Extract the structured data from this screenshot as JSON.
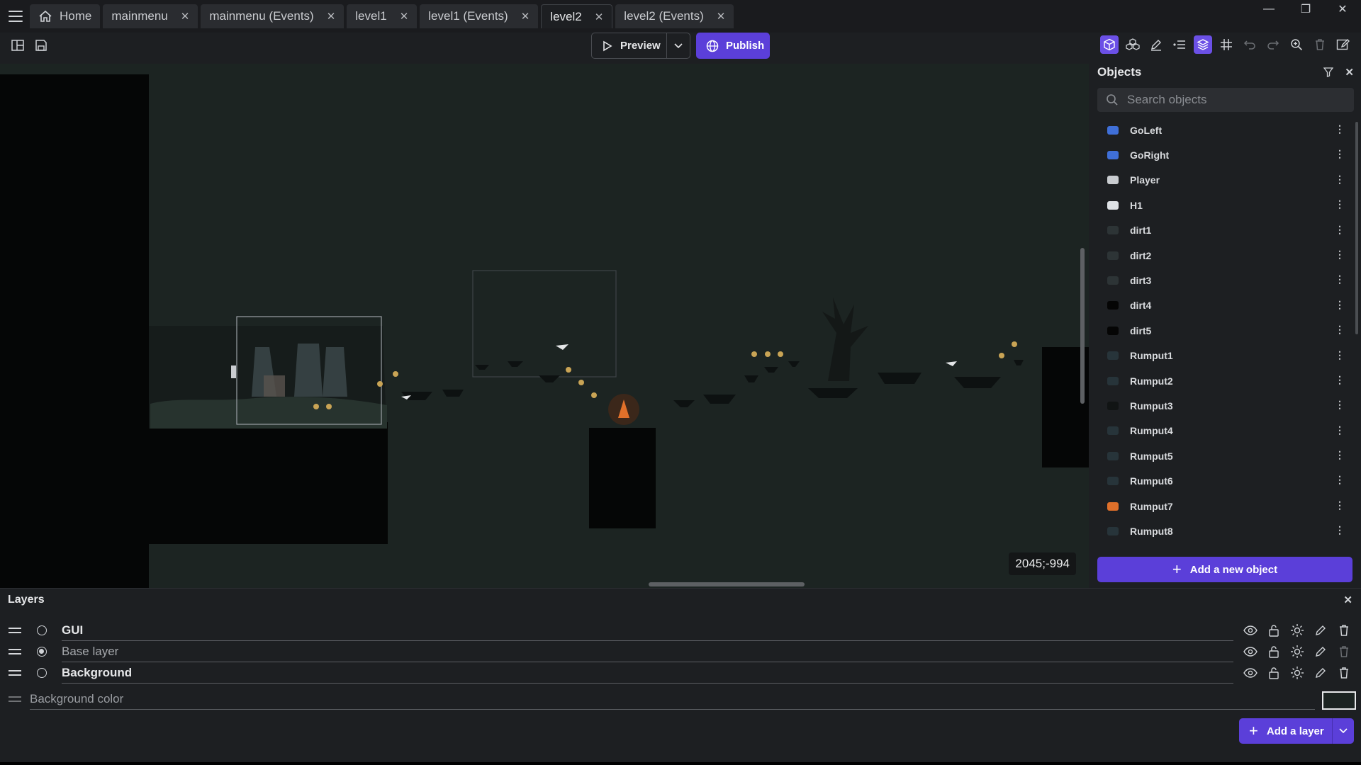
{
  "tabs": [
    {
      "label": "Home",
      "icon": "home-icon",
      "closable": false
    },
    {
      "label": "mainmenu",
      "closable": true
    },
    {
      "label": "mainmenu (Events)",
      "closable": true
    },
    {
      "label": "level1",
      "closable": true
    },
    {
      "label": "level1 (Events)",
      "closable": true
    },
    {
      "label": "level2",
      "closable": true,
      "active": true
    },
    {
      "label": "level2 (Events)",
      "closable": true
    }
  ],
  "toolbar": {
    "preview_label": "Preview",
    "publish_label": "Publish"
  },
  "canvas": {
    "coordinates": "2045;-994"
  },
  "objects_panel": {
    "title": "Objects",
    "search_placeholder": "Search objects",
    "items": [
      {
        "name": "GoLeft",
        "thumb_color": "#3f6fd8"
      },
      {
        "name": "GoRight",
        "thumb_color": "#3f6fd8"
      },
      {
        "name": "Player",
        "thumb_color": "#c9ccd0"
      },
      {
        "name": "H1",
        "thumb_color": "#dfe2e6"
      },
      {
        "name": "dirt1",
        "thumb_color": "#2d3436"
      },
      {
        "name": "dirt2",
        "thumb_color": "#2d3436"
      },
      {
        "name": "dirt3",
        "thumb_color": "#2d3436"
      },
      {
        "name": "dirt4",
        "thumb_color": "#050505"
      },
      {
        "name": "dirt5",
        "thumb_color": "#050505"
      },
      {
        "name": "Rumput1",
        "thumb_color": "#27343a"
      },
      {
        "name": "Rumput2",
        "thumb_color": "#27343a"
      },
      {
        "name": "Rumput3",
        "thumb_color": "#111414"
      },
      {
        "name": "Rumput4",
        "thumb_color": "#27343a"
      },
      {
        "name": "Rumput5",
        "thumb_color": "#27343a"
      },
      {
        "name": "Rumput6",
        "thumb_color": "#27343a"
      },
      {
        "name": "Rumput7",
        "thumb_color": "#e0702a"
      },
      {
        "name": "Rumput8",
        "thumb_color": "#27343a"
      }
    ],
    "add_label": "Add a new object"
  },
  "layers_panel": {
    "title": "Layers",
    "layers": [
      {
        "name": "GUI",
        "selected": false
      },
      {
        "name": "Base layer",
        "selected": true
      },
      {
        "name": "Background",
        "selected": false
      }
    ],
    "background_label": "Background color",
    "background_color": "#1c2422",
    "add_label": "Add a layer"
  }
}
